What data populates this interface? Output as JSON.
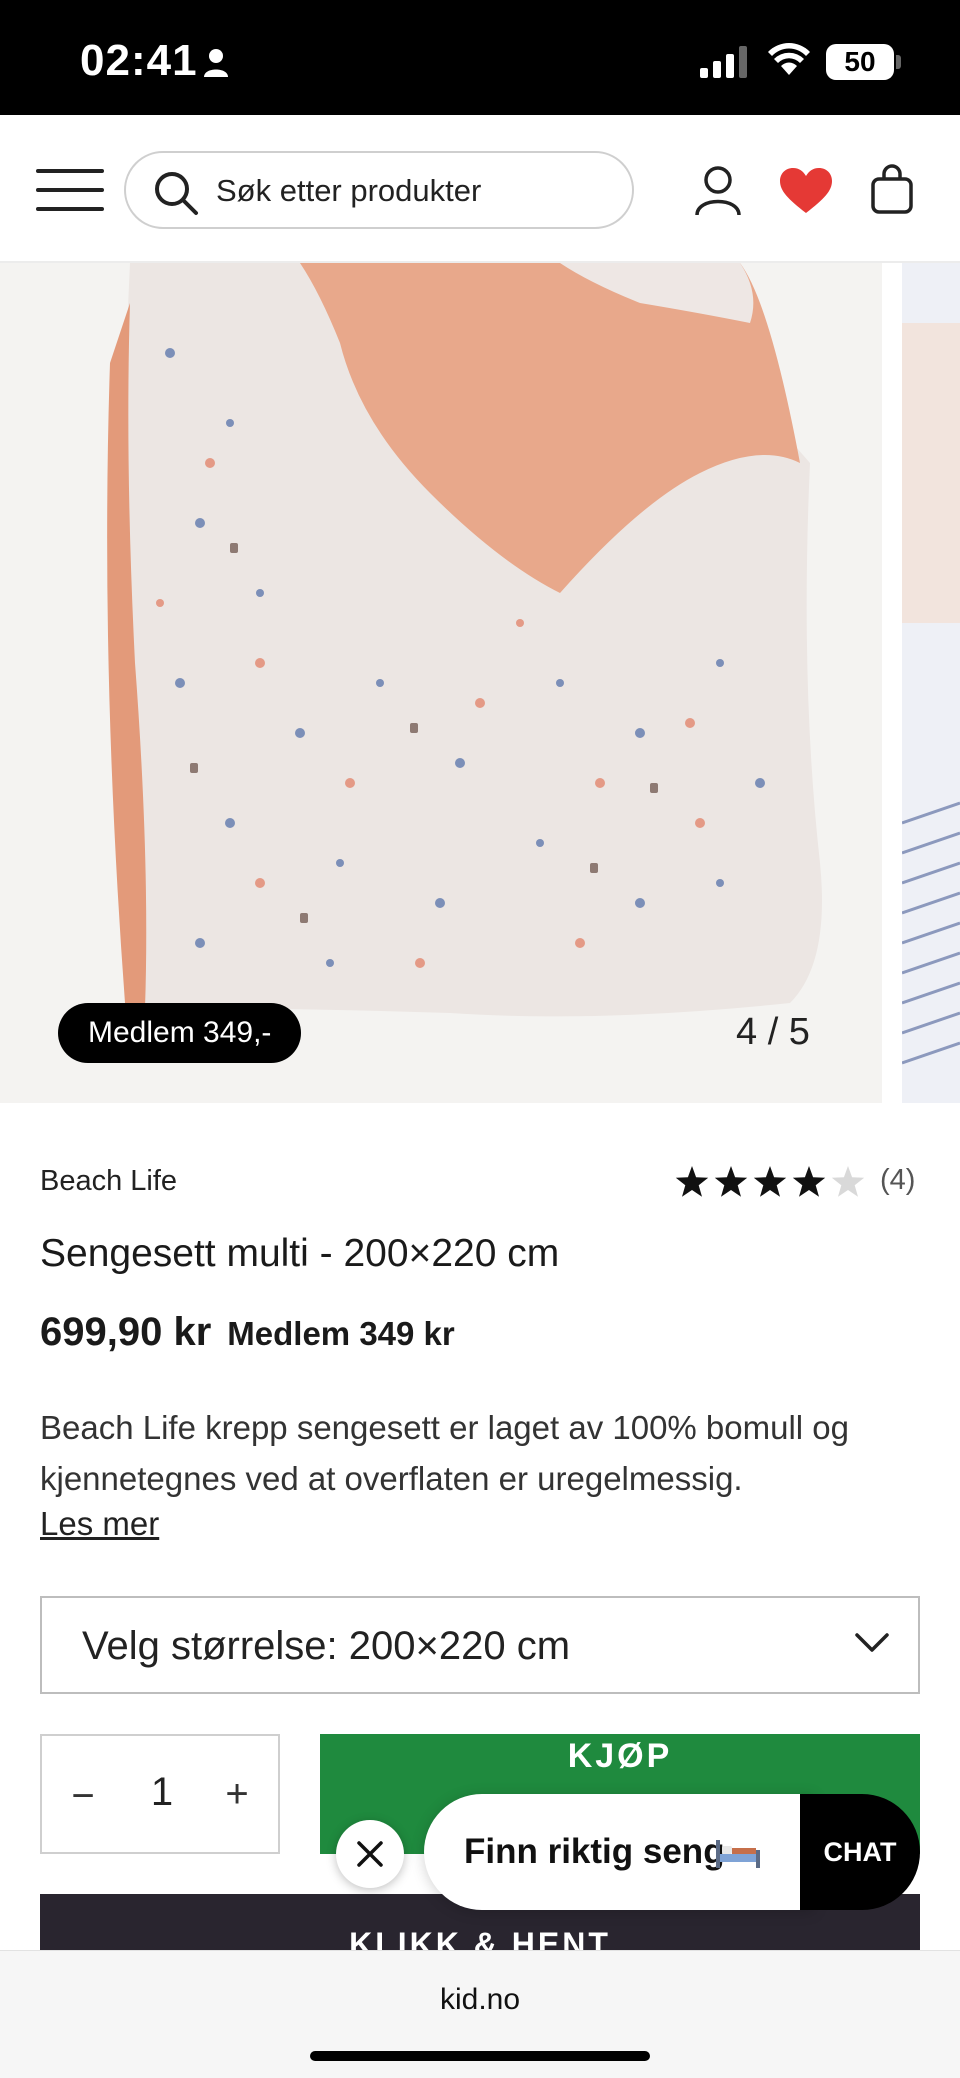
{
  "status_bar": {
    "time": "02:41",
    "battery": "50",
    "icons": [
      "person-icon",
      "signal-icon",
      "wifi-icon",
      "battery-icon"
    ]
  },
  "header": {
    "menu_icon": "hamburger-menu-icon",
    "search": {
      "placeholder": "Søk etter produkter",
      "value": ""
    },
    "icons": [
      "search-icon",
      "user-icon",
      "heart-icon",
      "bag-icon"
    ],
    "heart_color": "#e53935"
  },
  "gallery": {
    "member_badge": "Medlem 349,-",
    "counter": "4 / 5"
  },
  "product": {
    "brand": "Beach Life",
    "rating": {
      "stars": 4,
      "max": 5,
      "count": "(4)"
    },
    "title": "Sengesett multi - 200×220 cm",
    "price": "699,90 kr",
    "member_price": "Medlem 349 kr",
    "description": "Beach Life krepp sengesett er laget av 100% bomull og kjennetegnes ved at overflaten er uregelmessig.",
    "read_more": "Les mer"
  },
  "size_select": {
    "label": "Velg størrelse: 200×220 cm"
  },
  "quantity": {
    "minus": "−",
    "value": "1",
    "plus": "+"
  },
  "buttons": {
    "buy": "KJØP",
    "click_collect": "KLIKK & HENT",
    "buy_color": "#1f8a3e",
    "click_collect_color": "#29252f"
  },
  "chat": {
    "prompt": "Finn riktig seng",
    "chat_label": "CHAT"
  },
  "browser": {
    "url": "kid.no"
  }
}
